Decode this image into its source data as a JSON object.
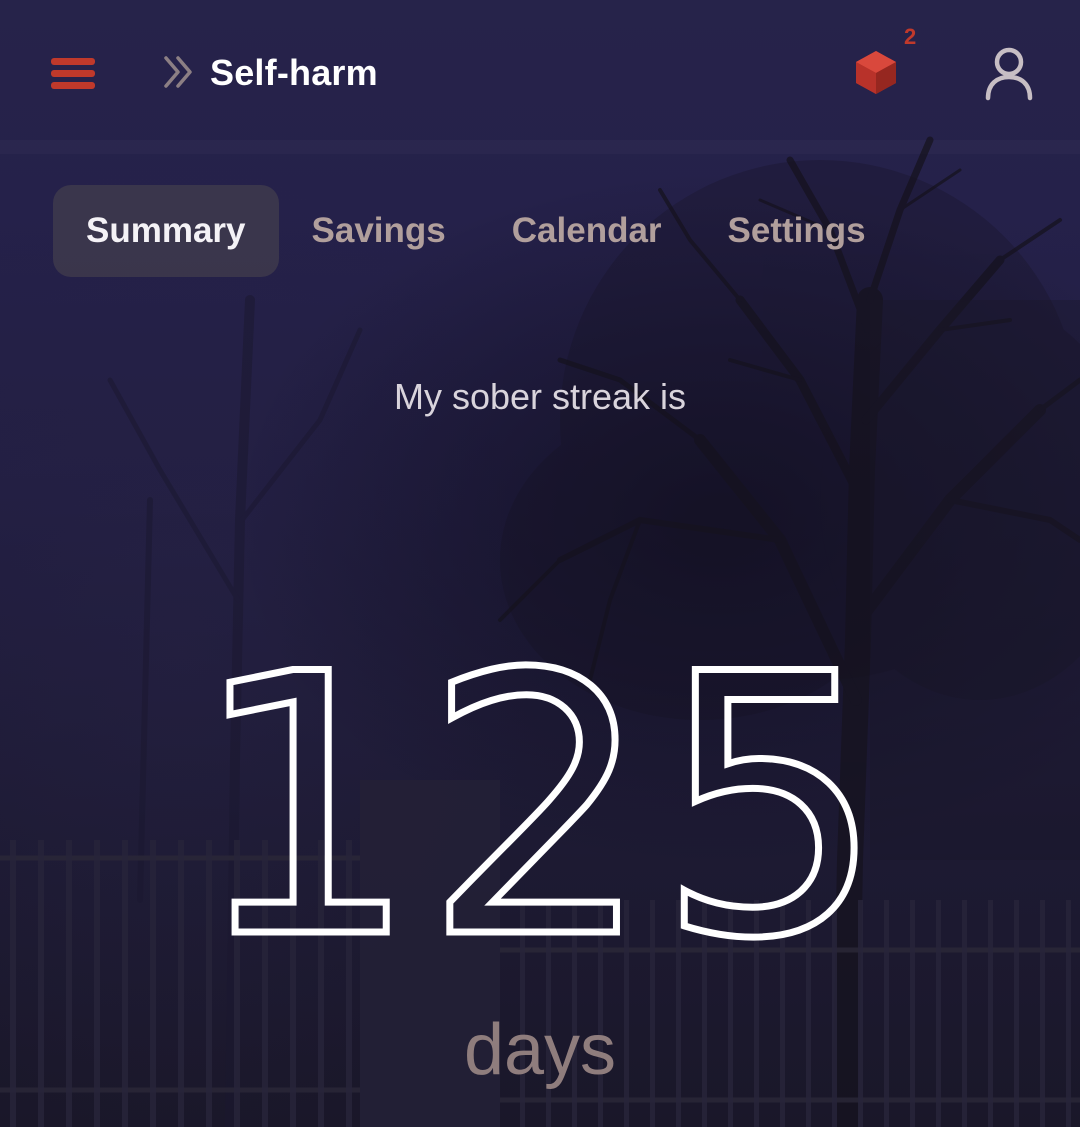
{
  "header": {
    "menu_icon": "hamburger-menu-icon",
    "breadcrumb_icon": "double-chevron-right-icon",
    "title": "Self-harm",
    "badge_icon": "red-cube-icon",
    "badge_count": "2",
    "account_icon": "user-outline-icon"
  },
  "tabs": [
    {
      "label": "Summary",
      "active": true
    },
    {
      "label": "Savings",
      "active": false
    },
    {
      "label": "Calendar",
      "active": false
    },
    {
      "label": "Settings",
      "active": false
    }
  ],
  "streak": {
    "intro": "My sober streak is",
    "value": "125",
    "unit": "days"
  },
  "colors": {
    "accent": "#c0392b",
    "background": "#221e42",
    "tab_inactive": "#b19f9c",
    "tab_active_bg": "#3e3a4c",
    "number": "#ffffff",
    "unit": "#8f7d7d"
  }
}
